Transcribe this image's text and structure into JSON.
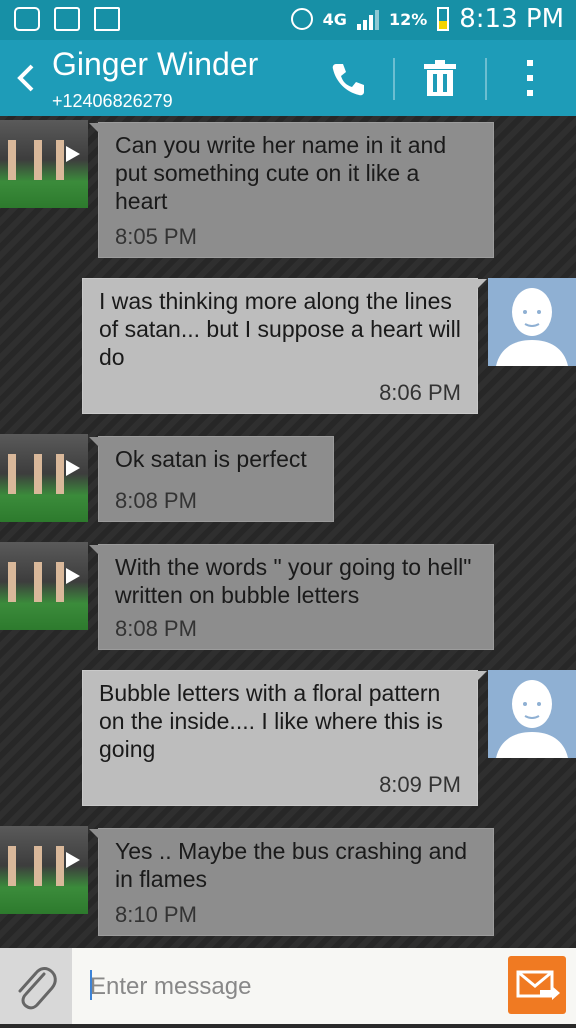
{
  "status_bar": {
    "icons": [
      "notification-icon",
      "mlb-icon",
      "image-mail-icon",
      "alarm-icon",
      "signal-icon",
      "battery-charging-icon"
    ],
    "network": "4G",
    "battery": "12%",
    "time": "8:13 PM"
  },
  "header": {
    "contact_name": "Ginger Winder",
    "contact_number": "+12406826279",
    "actions": [
      "phone-icon",
      "trash-icon",
      "more-vert-icon"
    ]
  },
  "messages": [
    {
      "direction": "incoming",
      "text": "Can you write her name in it and put something cute on it like a heart",
      "time": "8:05 PM"
    },
    {
      "direction": "outgoing",
      "text": "I was thinking more along the lines of satan... but I suppose a heart will do",
      "time": "8:06 PM"
    },
    {
      "direction": "incoming",
      "text": "Ok satan is perfect",
      "time": "8:08 PM"
    },
    {
      "direction": "incoming",
      "text": "With the words \" your going to hell\" written on bubble letters",
      "time": "8:08 PM"
    },
    {
      "direction": "outgoing",
      "text": "Bubble letters with a floral pattern on the inside.... I like where this is going",
      "time": "8:09 PM"
    },
    {
      "direction": "incoming",
      "text": "Yes .. Maybe the bus crashing and in flames",
      "time": "8:10 PM"
    }
  ],
  "compose": {
    "placeholder": "Enter message"
  },
  "colors": {
    "status_bar": "#1790a6",
    "action_bar": "#1e9cb8",
    "send_button": "#f07a22",
    "incoming_bubble": "#8d8d8d",
    "outgoing_bubble": "#bdbdbd"
  }
}
